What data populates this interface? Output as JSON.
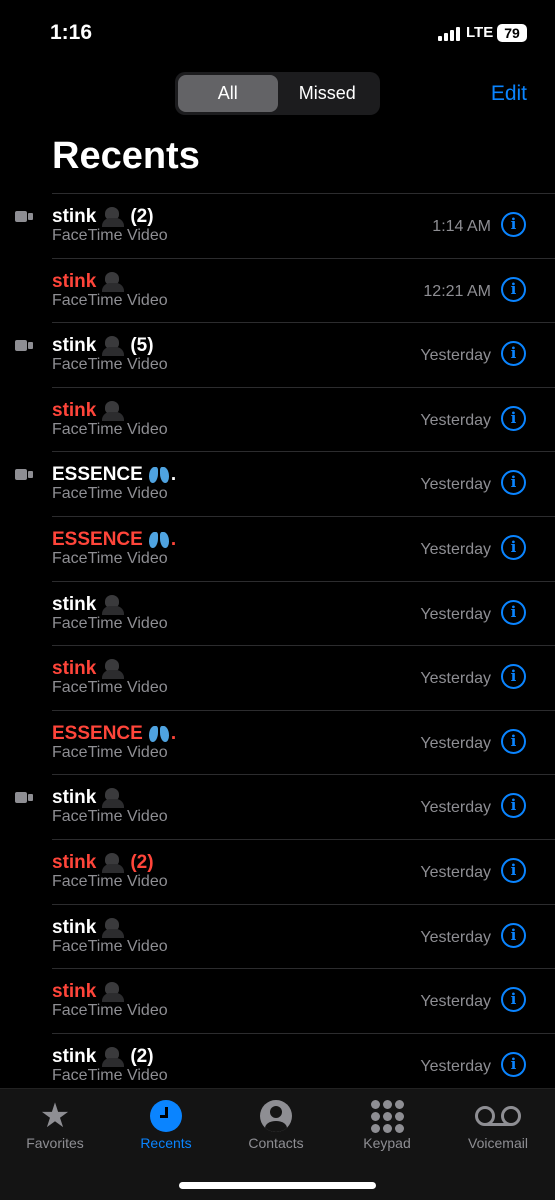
{
  "status": {
    "time": "1:16",
    "network": "LTE",
    "battery": "79"
  },
  "header": {
    "segments": [
      "All",
      "Missed"
    ],
    "selected": "All",
    "edit": "Edit",
    "title": "Recents"
  },
  "colors": {
    "accent": "#0a84ff",
    "missed": "#ff453a"
  },
  "calls": [
    {
      "name": "stink",
      "emoji": "ninja",
      "count": "(2)",
      "type": "FaceTime Video",
      "time": "1:14 AM",
      "missed": false,
      "video_icon": true
    },
    {
      "name": "stink",
      "emoji": "ninja",
      "count": "",
      "type": "FaceTime Video",
      "time": "12:21 AM",
      "missed": true,
      "video_icon": false
    },
    {
      "name": "stink",
      "emoji": "ninja",
      "count": "(5)",
      "type": "FaceTime Video",
      "time": "Yesterday",
      "missed": false,
      "video_icon": true
    },
    {
      "name": "stink",
      "emoji": "ninja",
      "count": "",
      "type": "FaceTime Video",
      "time": "Yesterday",
      "missed": true,
      "video_icon": false
    },
    {
      "name": "ESSENCE",
      "emoji": "butterfly",
      "suffix": ".",
      "count": "",
      "type": "FaceTime Video",
      "time": "Yesterday",
      "missed": false,
      "video_icon": true
    },
    {
      "name": "ESSENCE",
      "emoji": "butterfly",
      "suffix": ".",
      "count": "",
      "type": "FaceTime Video",
      "time": "Yesterday",
      "missed": true,
      "video_icon": false
    },
    {
      "name": "stink",
      "emoji": "ninja",
      "count": "",
      "type": "FaceTime Video",
      "time": "Yesterday",
      "missed": false,
      "video_icon": false
    },
    {
      "name": "stink",
      "emoji": "ninja",
      "count": "",
      "type": "FaceTime Video",
      "time": "Yesterday",
      "missed": true,
      "video_icon": false
    },
    {
      "name": "ESSENCE",
      "emoji": "butterfly",
      "suffix": ".",
      "count": "",
      "type": "FaceTime Video",
      "time": "Yesterday",
      "missed": true,
      "video_icon": false
    },
    {
      "name": "stink",
      "emoji": "ninja",
      "count": "",
      "type": "FaceTime Video",
      "time": "Yesterday",
      "missed": false,
      "video_icon": true
    },
    {
      "name": "stink",
      "emoji": "ninja",
      "count": "(2)",
      "type": "FaceTime Video",
      "time": "Yesterday",
      "missed": true,
      "video_icon": false
    },
    {
      "name": "stink",
      "emoji": "ninja",
      "count": "",
      "type": "FaceTime Video",
      "time": "Yesterday",
      "missed": false,
      "video_icon": false
    },
    {
      "name": "stink",
      "emoji": "ninja",
      "count": "",
      "type": "FaceTime Video",
      "time": "Yesterday",
      "missed": true,
      "video_icon": false
    },
    {
      "name": "stink",
      "emoji": "ninja",
      "count": "(2)",
      "type": "FaceTime Video",
      "time": "Yesterday",
      "missed": false,
      "video_icon": false
    }
  ],
  "tabs": [
    {
      "label": "Favorites",
      "icon": "star-icon"
    },
    {
      "label": "Recents",
      "icon": "clock-icon",
      "active": true
    },
    {
      "label": "Contacts",
      "icon": "person-icon"
    },
    {
      "label": "Keypad",
      "icon": "keypad-icon"
    },
    {
      "label": "Voicemail",
      "icon": "voicemail-icon"
    }
  ]
}
